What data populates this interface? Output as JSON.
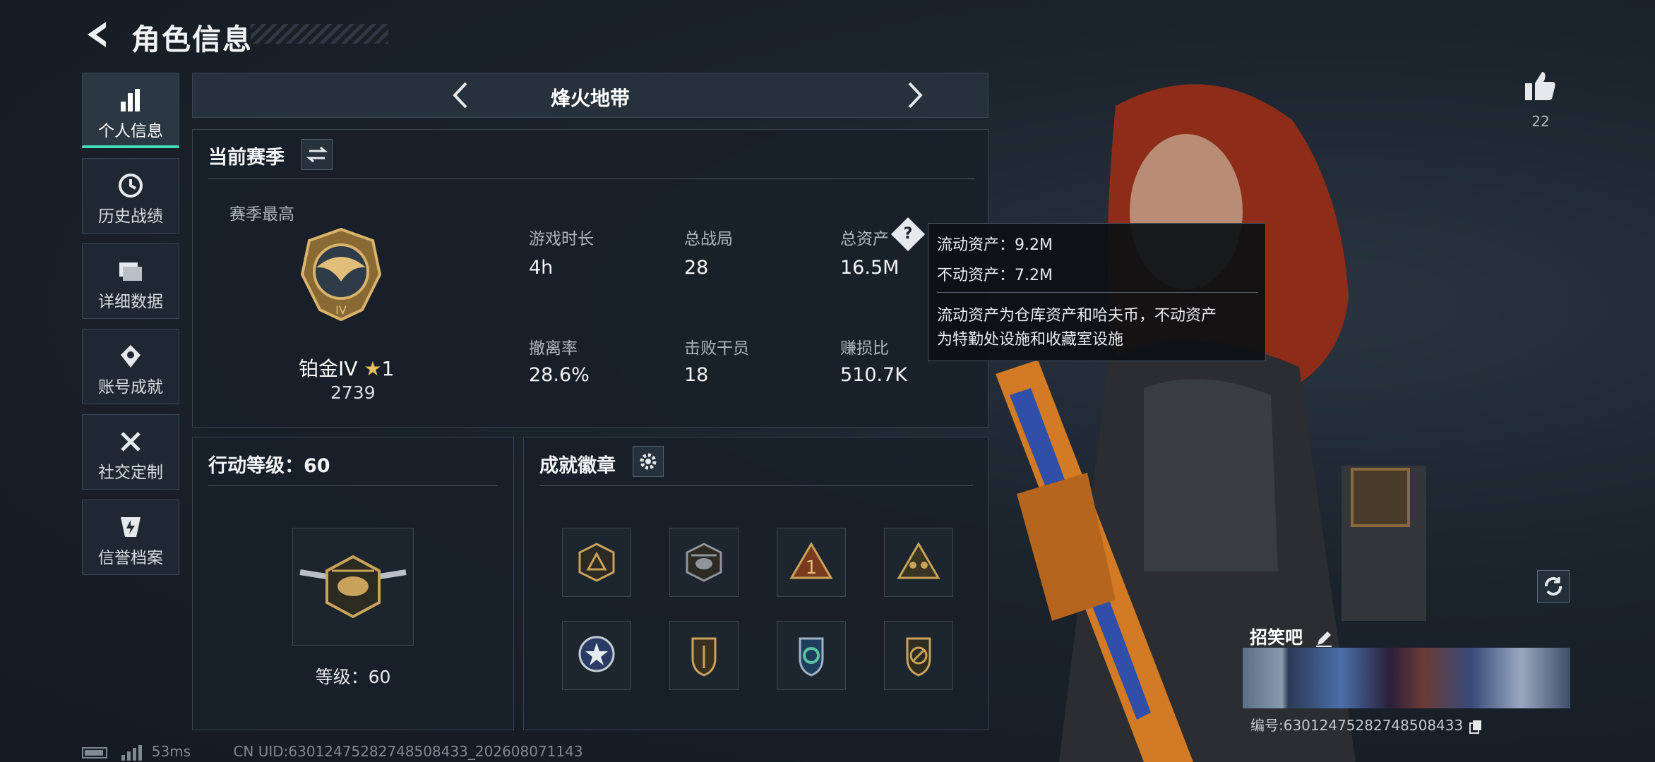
{
  "header": {
    "title": "角色信息"
  },
  "sidebar": {
    "items": [
      {
        "label": "个人信息",
        "icon": "bar-chart-icon",
        "active": true
      },
      {
        "label": "历史战绩",
        "icon": "clock-icon",
        "active": false
      },
      {
        "label": "详细数据",
        "icon": "folder-icon",
        "active": false
      },
      {
        "label": "账号成就",
        "icon": "medal-icon",
        "active": false
      },
      {
        "label": "社交定制",
        "icon": "tools-icon",
        "active": false
      },
      {
        "label": "信誉档案",
        "icon": "shield-icon",
        "active": false
      }
    ]
  },
  "mode": {
    "name": "烽火地带"
  },
  "season": {
    "title": "当前赛季",
    "best_label": "赛季最高",
    "rank_name": "铂金IV",
    "rank_stars": "1",
    "rank_score": "2739",
    "stats": [
      {
        "label": "游戏时长",
        "value": "4h"
      },
      {
        "label": "总战局",
        "value": "28"
      },
      {
        "label": "总资产",
        "value": "16.5M"
      },
      {
        "label": "撤离率",
        "value": "28.6%"
      },
      {
        "label": "击败干员",
        "value": "18"
      },
      {
        "label": "赚损比",
        "value": "510.7K"
      }
    ]
  },
  "tooltip": {
    "line1": "流动资产：9.2M",
    "line2": "不动资产：7.2M",
    "desc1": "流动资产为仓库资产和哈夫币，不动资产",
    "desc2": "为特勤处设施和收藏室设施"
  },
  "action": {
    "title": "行动等级：60",
    "level_text": "等级：60"
  },
  "badges": {
    "title": "成就徽章"
  },
  "likes": {
    "count": "22"
  },
  "card": {
    "name": "招笑吧",
    "serial": "编号:6301247528274850843​3"
  },
  "footer": {
    "ping": "53ms",
    "uid": "CN UID:6301247528274850843​3_202608071143"
  },
  "colors": {
    "accent": "#3fe0b6",
    "panel": "#182028",
    "gold": "#c9a35a"
  }
}
